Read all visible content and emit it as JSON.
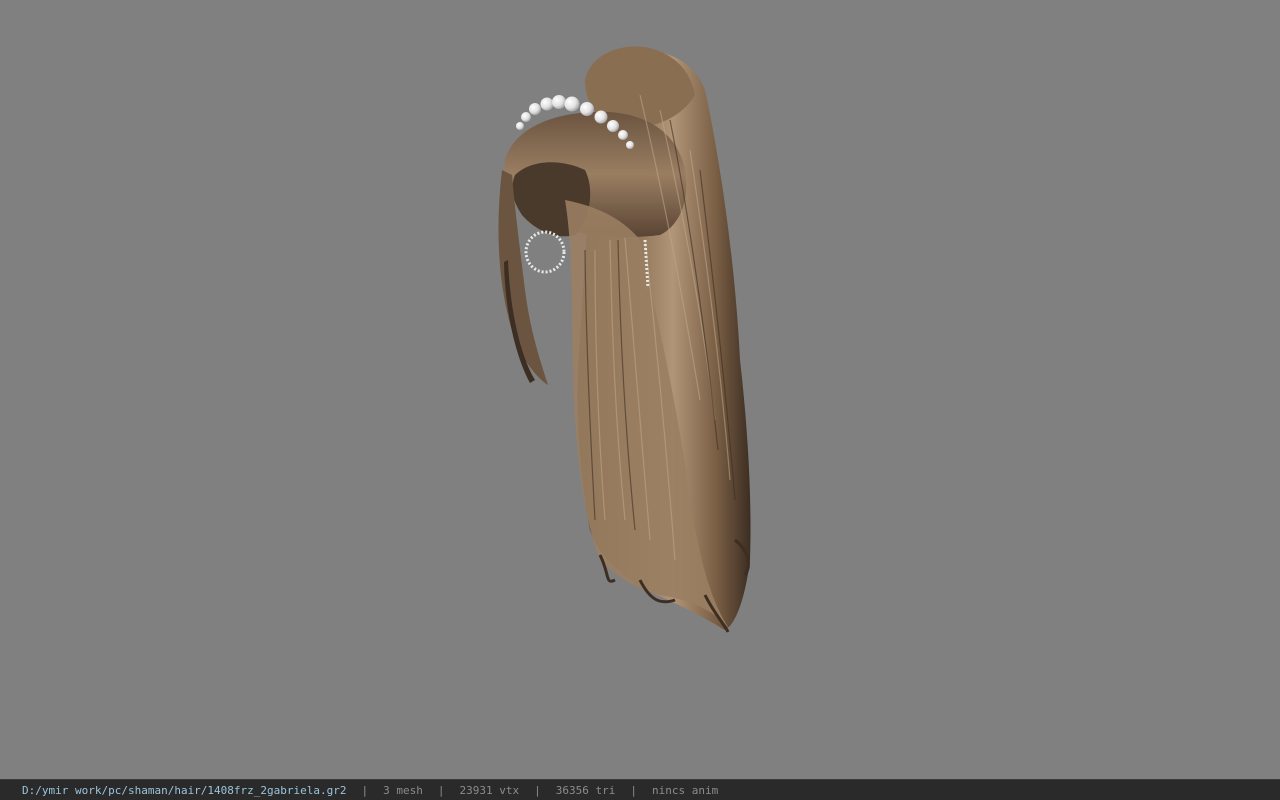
{
  "viewport": {
    "background_color": "#808080",
    "model": {
      "description_icon": "hair-ponytail-model",
      "hair_color": "#7a5f45",
      "accent_color": "#e8e8e8"
    }
  },
  "status_bar": {
    "file_path": "D:/ymir work/pc/shaman/hair/1408frz_2gabriela.gr2",
    "mesh_count": "3 mesh",
    "vertex_count": "23931 vtx",
    "triangle_count": "36356 tri",
    "anim_status": "nincs anim",
    "separator": "|",
    "colors": {
      "background": "#2a2a2a",
      "path_text": "#9bc4dc",
      "stat_text": "#8c8c8c"
    }
  }
}
